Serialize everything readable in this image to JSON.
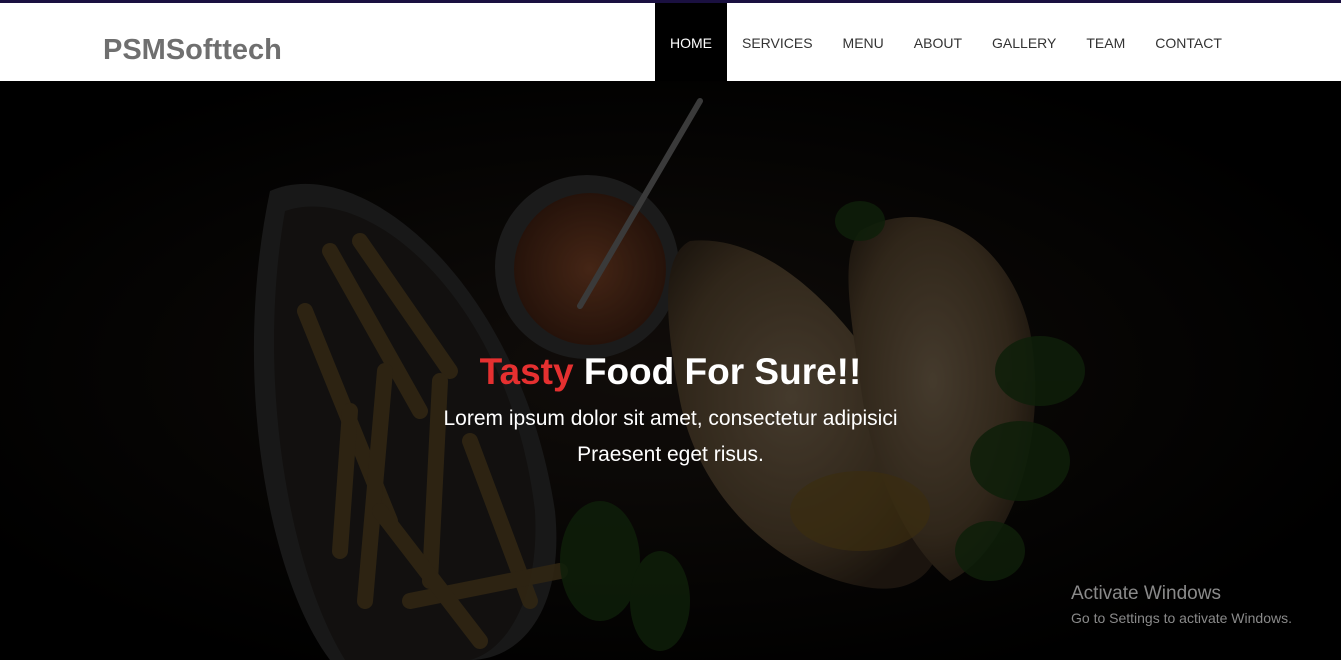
{
  "brand": {
    "name": "PSMSofttech"
  },
  "nav": {
    "items": [
      {
        "label": "HOME",
        "active": true
      },
      {
        "label": "SERVICES",
        "active": false
      },
      {
        "label": "MENU",
        "active": false
      },
      {
        "label": "ABOUT",
        "active": false
      },
      {
        "label": "GALLERY",
        "active": false
      },
      {
        "label": "TEAM",
        "active": false
      },
      {
        "label": "CONTACT",
        "active": false
      }
    ]
  },
  "hero": {
    "headline_accent": "Tasty",
    "headline_rest": "Food For Sure!!",
    "subtext_line1": "Lorem ipsum dolor sit amet, consectetur adipisici",
    "subtext_line2": "Praesent eget risus."
  },
  "watermark": {
    "title": "Activate Windows",
    "subtitle": "Go to Settings to activate Windows."
  },
  "colors": {
    "accent": "#e53030",
    "nav_active_bg": "#000000",
    "brand_text": "#6f6f6f"
  }
}
